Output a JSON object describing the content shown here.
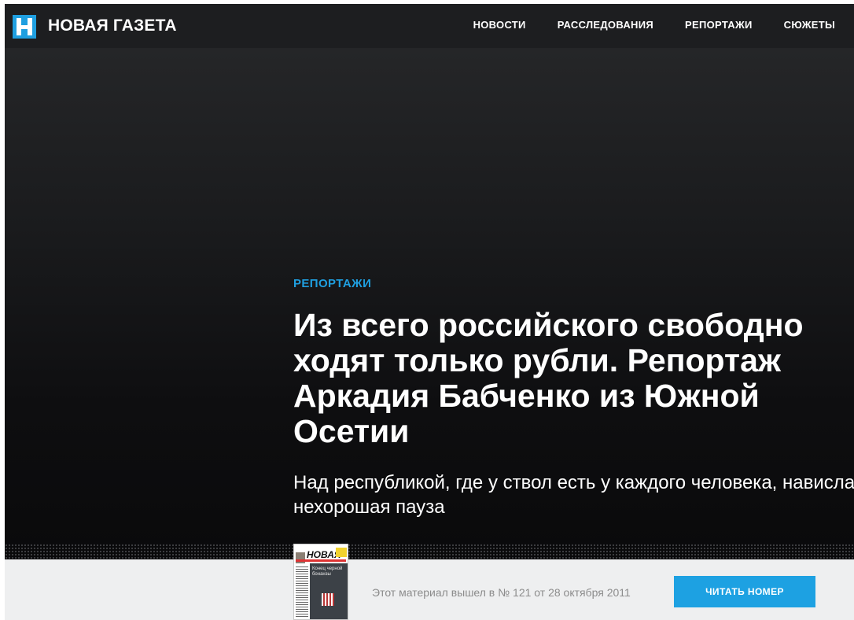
{
  "header": {
    "logo_text": "НОВАЯ ГАЗЕТА",
    "nav": [
      "НОВОСТИ",
      "РАССЛЕДОВАНИЯ",
      "РЕПОРТАЖИ",
      "СЮЖЕТЫ"
    ]
  },
  "article": {
    "rubric": "РЕПОРТАЖИ",
    "title_lines": [
      "Из всего российского свободно",
      "ходят только рубли. Репортаж",
      "Аркадия Бабченко из Южной",
      "Осетии"
    ],
    "lead": "Над республикой, где у ствол есть у каждого человека, нависла нехорошая пауза"
  },
  "issue": {
    "text": "Этот материал вышел в № 121 от 28 октября 2011",
    "button": "ЧИТАТЬ НОМЕР",
    "cover_masthead": "НОВАЯ",
    "cover_headline": "Конец черной бонанзы"
  },
  "colors": {
    "accent": "#1f9fe0",
    "header_bg": "#1d1e20",
    "strip_bg": "#eeeff0"
  },
  "icons": {
    "logo": "newspaper-logo-icon"
  }
}
